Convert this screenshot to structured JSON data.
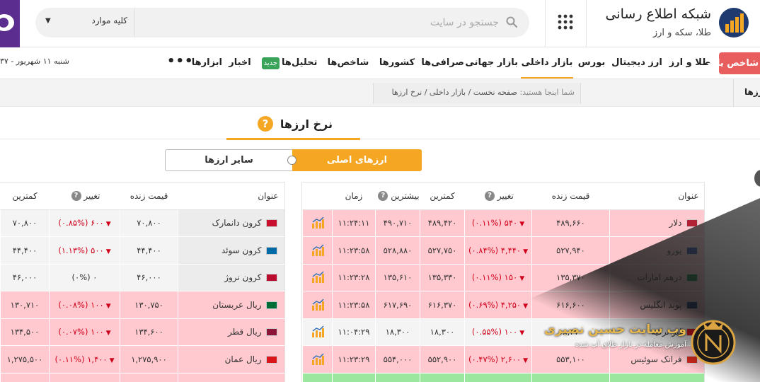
{
  "header": {
    "site_title": "شبکه اطلاع رسانی",
    "site_subtitle": "طلا، سکه و ارز",
    "search_placeholder": "جستجو در سایت",
    "category_select": "کلیه موارد"
  },
  "nav": {
    "items": [
      "طلا و ارز",
      "ارز دیجیتال",
      "بورس",
      "بازار داخلی",
      "بازار جهانی",
      "صرافی‌ها",
      "کشورها",
      "شاخص‌ها",
      "تحلیل‌ها",
      "اخبار",
      "ابزارها"
    ],
    "new_badge": "جدید",
    "more": "•••",
    "date": "شنبه ۱۱ شهریور - ۳۷",
    "red_button": "شاخص یاب"
  },
  "breadcrumb": {
    "side_label": "ارزها",
    "here_label": "شما اینجا هستید:",
    "path": "صفحه نخست / بازار داخلی / نرخ ارزها"
  },
  "page_title": "نرخ ارزها",
  "tabs": {
    "main": "ارزهای اصلی",
    "other": "سایر ارزها"
  },
  "right_table": {
    "headers": [
      "عنوان",
      "قیمت زنده",
      "تغییر",
      "کمترین",
      "بیشترین",
      "زمان"
    ],
    "rows": [
      {
        "name": "دلار",
        "price": "۴۸۹,۶۶۰",
        "change": "۵۴۰ (۰.۱۱%)",
        "low": "۴۸۹,۴۲۰",
        "high": "۴۹۰,۷۱۰",
        "time": "۱۱:۲۴:۱۱",
        "flag": "#b22234"
      },
      {
        "name": "یورو",
        "price": "۵۲۷,۹۴۰",
        "change": "۴,۴۴۰ (۰.۸۴%)",
        "low": "۵۲۷,۷۵۰",
        "high": "۵۲۸,۸۸۰",
        "time": "۱۱:۲۳:۵۸",
        "flag": "#1f3d99"
      },
      {
        "name": "درهم امارات",
        "price": "۱۳۵,۳۷۰",
        "change": "۱۵۰ (۰.۱۱%)",
        "low": "۱۳۵,۳۳۰",
        "high": "۱۳۵,۶۱۰",
        "time": "۱۱:۲۳:۲۸",
        "flag": "#00732f"
      },
      {
        "name": "پوند انگلیس",
        "price": "۶۱۶,۶۰۰",
        "change": "۴,۲۵۰ (۰.۶۹%)",
        "low": "۶۱۶,۳۷۰",
        "high": "۶۱۷,۶۹۰",
        "time": "۱۱:۲۳:۵۸",
        "flag": "#012169"
      },
      {
        "name": "لیر ترکیه",
        "price": "۱۸,۳۷۰",
        "change": "۱۰۰ (۰.۵۵%)",
        "low": "۱۸,۳۰۰",
        "high": "۱۸,۳۰۰",
        "time": "۱۱:۰۴:۲۹",
        "flag": "#e30a17"
      },
      {
        "name": "فرانک سوئیس",
        "price": "۵۵۳,۱۰۰",
        "change": "۲,۶۰۰ (۰.۴۷%)",
        "low": "۵۵۲,۹۰۰",
        "high": "۵۵۴,۰۰۰",
        "time": "۱۱:۲۳:۲۹",
        "flag": "#d52b1e"
      }
    ]
  },
  "left_table": {
    "headers": [
      "عنوان",
      "قیمت زنده",
      "تغییر",
      "کمترین"
    ],
    "rows": [
      {
        "name": "کرون دانمارک",
        "price": "۷۰,۸۰۰",
        "change": "۶۰۰ (۰.۸۵%)",
        "low": "۷۰,۸۰۰",
        "flag": "#c8102e"
      },
      {
        "name": "کرون سوئد",
        "price": "۴۴,۴۰۰",
        "change": "۵۰۰ (۱.۱۳%)",
        "low": "۴۴,۴۰۰",
        "flag": "#006aa7"
      },
      {
        "name": "کرون نروژ",
        "price": "۴۶,۰۰۰",
        "change": "۰ (۰%)",
        "low": "۴۶,۰۰۰",
        "flag": "#ba0c2f"
      },
      {
        "name": "ریال عربستان",
        "price": "۱۳۰,۷۵۰",
        "change": "۱۰۰ (۰.۰۸%)",
        "low": "۱۳۰,۷۱۰",
        "flag": "#006c35"
      },
      {
        "name": "ریال قطر",
        "price": "۱۳۴,۶۰۰",
        "change": "۱۰۰ (۰.۰۷%)",
        "low": "۱۳۴,۵۰۰",
        "flag": "#8a1538"
      },
      {
        "name": "ریال عمان",
        "price": "۱,۲۷۵,۹۰۰",
        "change": "۱,۴۰۰ (۰.۱۱%)",
        "low": "۱,۲۷۵,۵۰۰",
        "flag": "#db161b"
      }
    ]
  },
  "watermark": {
    "title": "وب سایت حسین نصیری",
    "subtitle": "آموزش معامله در بازار طلای آب شده"
  }
}
